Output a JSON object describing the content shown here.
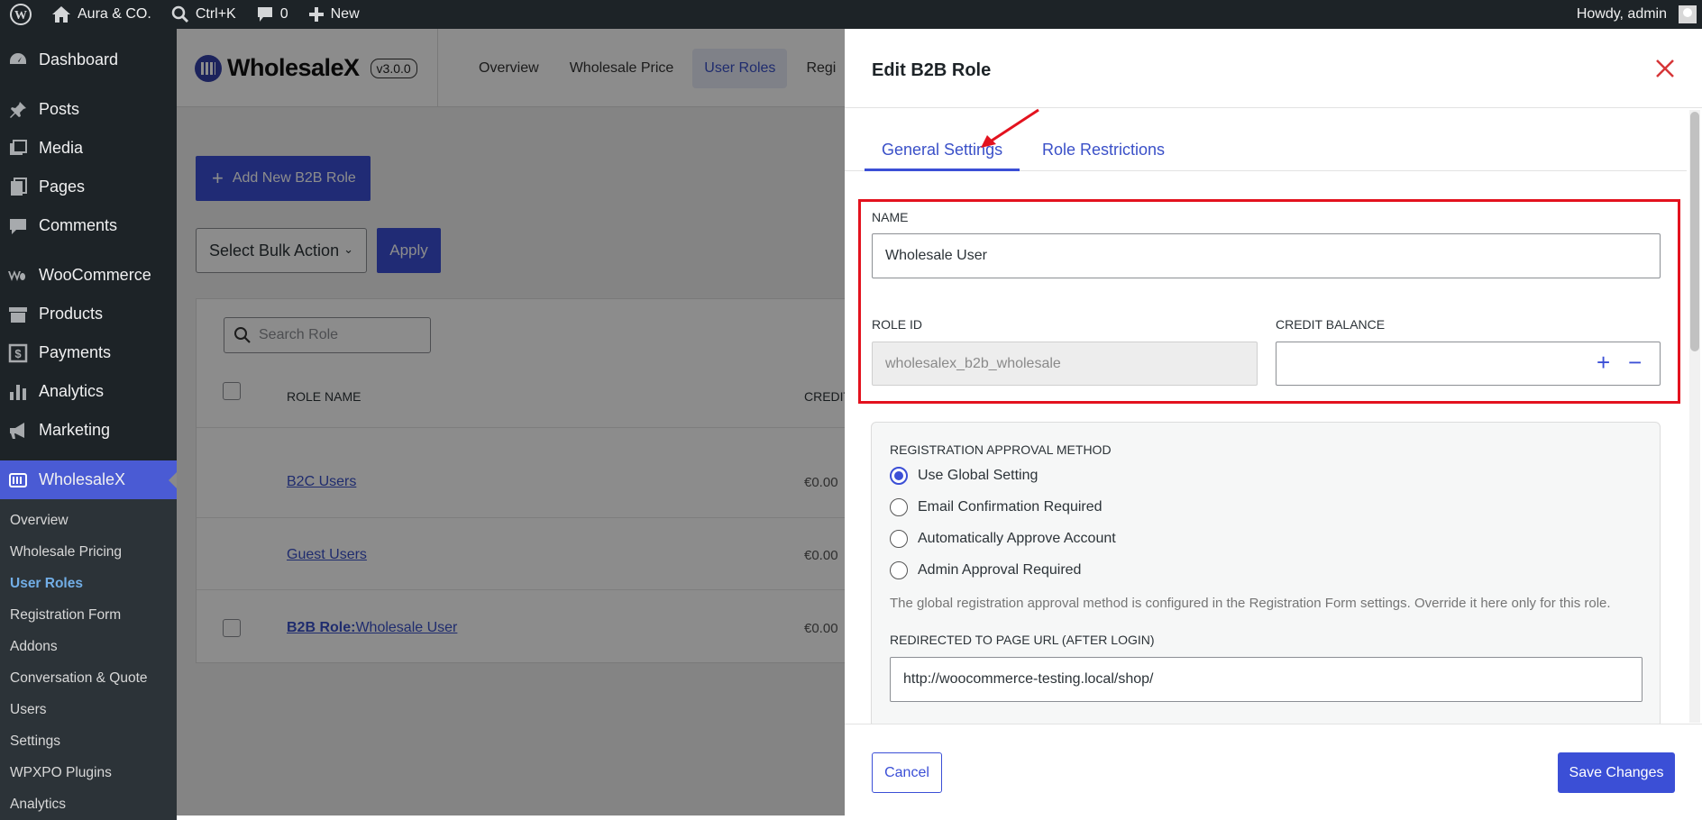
{
  "admin_bar": {
    "site_name": "Aura & CO.",
    "search_shortcut": "Ctrl+K",
    "comments_count": "0",
    "new_label": "New",
    "howdy": "Howdy, admin"
  },
  "sidebar": {
    "items": [
      {
        "label": "Dashboard",
        "icon": "dashboard-icon"
      },
      {
        "label": "Posts",
        "icon": "pin-icon"
      },
      {
        "label": "Media",
        "icon": "media-icon"
      },
      {
        "label": "Pages",
        "icon": "pages-icon"
      },
      {
        "label": "Comments",
        "icon": "comment-icon"
      },
      {
        "label": "WooCommerce",
        "icon": "woo-icon"
      },
      {
        "label": "Products",
        "icon": "archive-icon"
      },
      {
        "label": "Payments",
        "icon": "dollar-icon"
      },
      {
        "label": "Analytics",
        "icon": "bar-chart-icon"
      },
      {
        "label": "Marketing",
        "icon": "megaphone-icon"
      }
    ],
    "active": {
      "label": "WholesaleX",
      "icon": "wholesalex-icon"
    },
    "submenu": [
      "Overview",
      "Wholesale Pricing",
      "User Roles",
      "Registration Form",
      "Addons",
      "Conversation & Quote",
      "Users",
      "Settings",
      "WPXPO Plugins",
      "Analytics"
    ],
    "current_sub": "User Roles"
  },
  "plugin": {
    "name": "WholesaleX",
    "version": "v3.0.0",
    "tabs": [
      "Overview",
      "Wholesale Price",
      "User Roles",
      "Regi"
    ],
    "active_tab": "User Roles",
    "add_button": "Add New B2B Role",
    "bulk_action": "Select Bulk Action",
    "apply": "Apply",
    "search_placeholder": "Search Role",
    "columns": {
      "role_name": "ROLE NAME",
      "credit": "CREDIT"
    },
    "rows": [
      {
        "prefix": "",
        "name": "B2C Users",
        "credit": "€0.00"
      },
      {
        "prefix": "",
        "name": "Guest Users",
        "credit": "€0.00"
      },
      {
        "prefix": "B2B Role:",
        "name": "Wholesale User",
        "credit": "€0.00"
      }
    ]
  },
  "modal": {
    "title": "Edit B2B Role",
    "tabs": [
      "General Settings",
      "Role Restrictions"
    ],
    "active_tab": "General Settings",
    "name_label": "NAME",
    "name_value": "Wholesale User",
    "role_id_label": "ROLE ID",
    "role_id_placeholder": "wholesalex_b2b_wholesale",
    "credit_label": "CREDIT BALANCE",
    "credit_value": "",
    "registration": {
      "label": "REGISTRATION APPROVAL METHOD",
      "options": [
        "Use Global Setting",
        "Email Confirmation Required",
        "Automatically Approve Account",
        "Admin Approval Required"
      ],
      "selected": "Use Global Setting",
      "help": "The global registration approval method is configured in the Registration Form settings. Override it here only for this role."
    },
    "redirect_label": "REDIRECTED TO PAGE URL (AFTER LOGIN)",
    "redirect_value": "http://woocommerce-testing.local/shop/",
    "cancel": "Cancel",
    "save": "Save Changes"
  },
  "colors": {
    "accent": "#3b4fd6",
    "highlight": "#e3121e",
    "admin_bar": "#1d2327"
  }
}
